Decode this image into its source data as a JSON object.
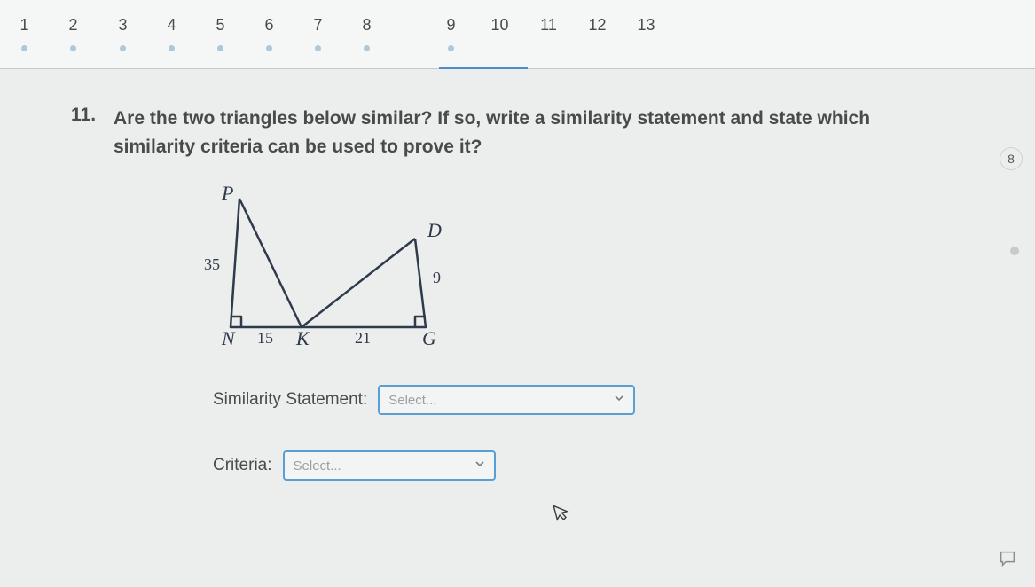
{
  "nav": {
    "items": [
      "1",
      "2",
      "3",
      "4",
      "5",
      "6",
      "7",
      "8",
      "9",
      "10",
      "11",
      "12",
      "13"
    ],
    "badge": "8"
  },
  "question": {
    "number": "11.",
    "text": "Are the two triangles below similar? If so, write a similarity statement and state which similarity criteria can be used to prove it?"
  },
  "figure": {
    "labels": {
      "P": "P",
      "D": "D",
      "N": "N",
      "K": "K",
      "G": "G"
    },
    "lengths": {
      "PN": "35",
      "NK": "15",
      "KG": "21",
      "DG": "9"
    }
  },
  "answers": {
    "similarity_label": "Similarity Statement:",
    "similarity_placeholder": "Select...",
    "criteria_label": "Criteria:",
    "criteria_placeholder": "Select..."
  }
}
